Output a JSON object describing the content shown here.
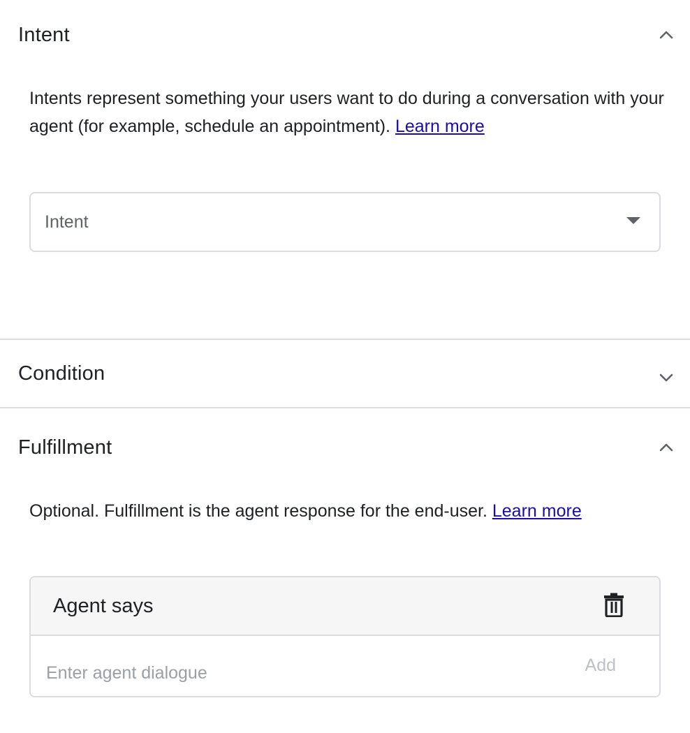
{
  "intent_section": {
    "title": "Intent",
    "description": "Intents represent something your users want to do during a conversation with your agent (for example, schedule an appointment).",
    "learn_more": "Learn more",
    "select_label": "Intent",
    "expanded": true
  },
  "condition_section": {
    "title": "Condition",
    "expanded": false
  },
  "fulfillment_section": {
    "title": "Fulfillment",
    "description": "Optional. Fulfillment is the agent response for the end-user.",
    "learn_more": "Learn more",
    "expanded": true,
    "agent_says": {
      "title": "Agent says",
      "input_placeholder": "Enter agent dialogue",
      "add_label": "Add"
    }
  },
  "icons": {
    "collapse": "chevron-up-icon",
    "expand": "chevron-down-icon",
    "dropdown": "dropdown-arrow-icon",
    "delete": "trash-icon"
  },
  "colors": {
    "text": "#202124",
    "link": "#1a0dab",
    "border": "#dadce0",
    "card_header_bg": "#f6f6f6",
    "disabled": "#bdc1c6"
  }
}
